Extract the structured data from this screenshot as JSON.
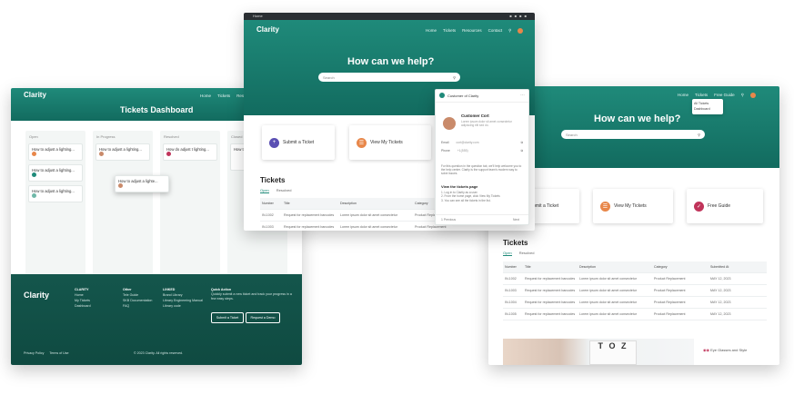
{
  "brand": "Clarity",
  "left": {
    "nav": [
      "Home",
      "Tickets",
      "Res"
    ],
    "title": "Tickets Dashboard",
    "columns": [
      "Open",
      "In Progress",
      "Resolved",
      "Closed"
    ],
    "card_title": "How to adjust a lighting...",
    "card_title_short": "How do adjust t lighting...",
    "drag_card": "How to adjust a lighte...",
    "footer": {
      "c1": [
        "CLARITY",
        "Home",
        "My Tickets",
        "Dashboard"
      ],
      "c2": [
        "Other",
        "Tele Guide",
        "SKB Documentation",
        "FAQ"
      ],
      "c3": [
        "LINKED",
        "Brand Library",
        "Library Engineering Manual",
        "Library code"
      ],
      "c4_title": "Quick Action",
      "c4_text": "Quickly submit a new ticket and track your progress in a few easy steps.",
      "btn1": "Submit a Ticket",
      "btn2": "Request a Demo",
      "bottom_links": [
        "Privacy Policy",
        "Terms of Use"
      ],
      "copyright": "© 2023 Clarity. All rights reserved."
    }
  },
  "middle": {
    "tab": "Home",
    "nav": [
      "Home",
      "Tickets",
      "Resources",
      "Contact"
    ],
    "hero": "How can we help?",
    "search_placeholder": "Search",
    "actions": [
      "Submit a Ticket",
      "View My Tickets"
    ],
    "tickets_title": "Tickets",
    "tabs": [
      "Open",
      "Resolved"
    ],
    "table_headers": [
      "Number",
      "Title",
      "Description",
      "Category"
    ],
    "rows": [
      [
        "IN-1002",
        "Request for replacement barcodes",
        "Lorem ipsum dolor sit amet consectetur",
        "Product Replacement"
      ],
      [
        "IN-1003",
        "Request for replacement barcodes",
        "Lorem ipsum dolor sit amet consectetur",
        "Product Replacement"
      ]
    ]
  },
  "popup": {
    "title": "Customer of Clarity",
    "contact_name": "Customer Cort",
    "contact_text": "Lorem ipsum dolor sit amet consectetur adipiscing elit sed do.",
    "email_label": "Email",
    "email_value": "cort@clarity.com",
    "phone_label": "Phone",
    "phone_value": "+1(555)",
    "body": "For this question in the question tab, we'll help welcome you to the help center. Clarity is the support team's modern way to solve issues.",
    "view_title": "View the tickets page",
    "steps": [
      "1. Log in to Clarity as a user.",
      "2. From the home page, click View My Tickets",
      "3. You can see all the tickets in the list."
    ],
    "footer_left": "1 Previous",
    "footer_right": "Next"
  },
  "right": {
    "nav": [
      "Home",
      "Tickets",
      "Free Guide"
    ],
    "dropdown": [
      "All Tickets",
      "Dashboard"
    ],
    "hero": "How can we help?",
    "search_placeholder": "Search",
    "actions": [
      "Submit a Ticket",
      "View My Tickets",
      "Free Guide"
    ],
    "tickets_title": "Tickets",
    "tabs": [
      "Open",
      "Resolved"
    ],
    "table_headers": [
      "Number",
      "Title",
      "Description",
      "Category",
      "Submitted At"
    ],
    "rows": [
      [
        "IN-1002",
        "Request for replacement barcodes",
        "Lorem ipsum dolor sit amet consectetur",
        "Product Replacement",
        "MAY 12, 2023"
      ],
      [
        "IN-1003",
        "Request for replacement barcodes",
        "Lorem ipsum dolor sit amet consectetur",
        "Product Replacement",
        "MAY 12, 2023"
      ],
      [
        "IN-1004",
        "Request for replacement barcodes",
        "Lorem ipsum dolor sit amet consectetur",
        "Product Replacement",
        "MAY 12, 2023"
      ],
      [
        "IN-1005",
        "Request for replacement barcodes",
        "Lorem ipsum dolor sit amet consectetur",
        "Product Replacement",
        "MAY 12, 2023"
      ]
    ],
    "promo": "Eye Glasses and Style"
  },
  "colors": {
    "teal": "#1f8a7a",
    "deep_teal": "#0f4a41",
    "accent_purple": "#5a4fb3",
    "accent_orange": "#e8874a",
    "accent_red": "#c0345a"
  }
}
